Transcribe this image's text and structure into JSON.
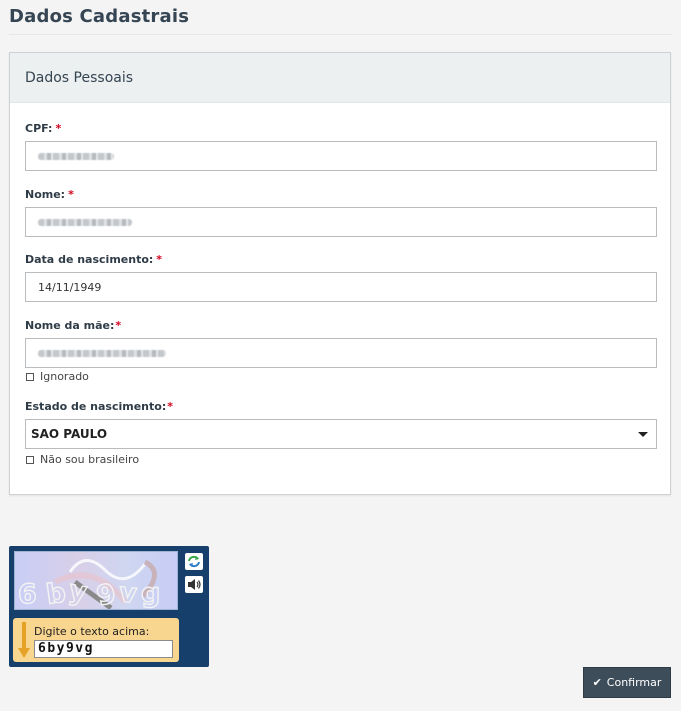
{
  "page": {
    "title": "Dados Cadastrais"
  },
  "panel": {
    "title": "Dados Pessoais"
  },
  "form": {
    "required_mark": "*",
    "cpf": {
      "label": "CPF:",
      "value_masked": true
    },
    "nome": {
      "label": "Nome:",
      "value_masked": true
    },
    "data_nascimento": {
      "label": "Data de nascimento:",
      "value": "14/11/1949"
    },
    "nome_mae": {
      "label": "Nome da mãe:",
      "value_masked": true
    },
    "ignorado": {
      "label": "Ignorado",
      "checked": false
    },
    "estado_nascimento": {
      "label": "Estado de nascimento:",
      "selected": "SAO PAULO"
    },
    "nao_brasileiro": {
      "label": "Não sou brasileiro",
      "checked": false
    }
  },
  "captcha": {
    "image_text": "6 by 9 vg",
    "prompt": "Digite o texto acima:",
    "input_value": "6by9vg",
    "refresh_icon": "refresh-icon",
    "audio_icon": "speaker-icon"
  },
  "actions": {
    "confirm_label": "Confirmar",
    "confirm_icon": "checkmark-icon"
  },
  "colors": {
    "required": "#d0021b",
    "confirm_bg": "#3e4d5a",
    "captcha_bg": "#173f6b",
    "captcha_entry_bg": "#f9d68f"
  }
}
